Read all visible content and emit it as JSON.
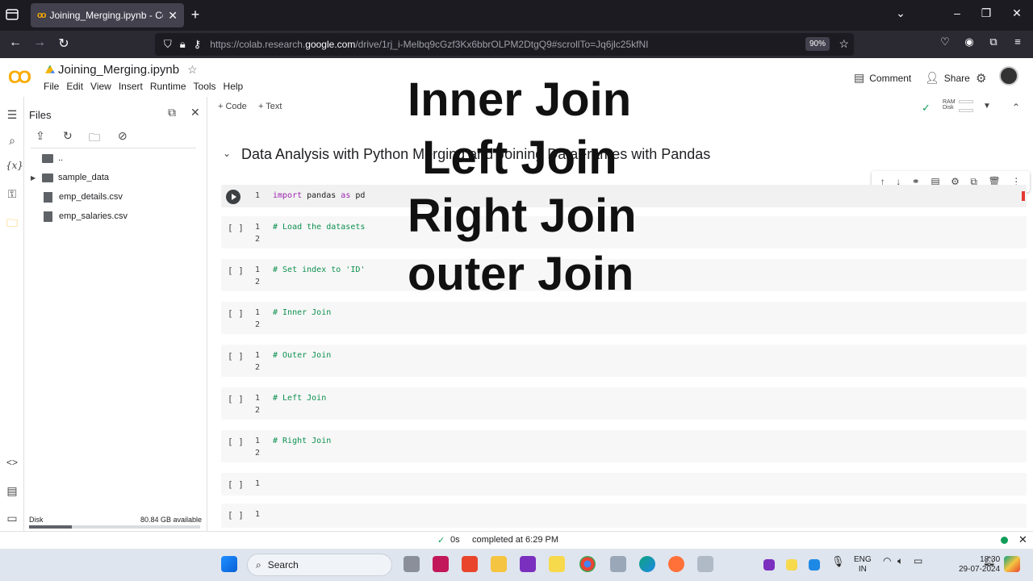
{
  "browser": {
    "tab_title": "Joining_Merging.ipynb - Colab",
    "url_prefix": "https://colab.research.",
    "url_domain": "google.com",
    "url_suffix": "/drive/1rj_i-Melbq9cGzf3Kx6bbrOLPM2DtgQ9#scrollTo=Jq6jlc25kfNI",
    "zoom": "90%"
  },
  "colab": {
    "logo": "CO",
    "title": "Joining_Merging.ipynb",
    "menu": [
      "File",
      "Edit",
      "View",
      "Insert",
      "Runtime",
      "Tools",
      "Help"
    ],
    "comment_label": "Comment",
    "share_label": "Share"
  },
  "files_panel": {
    "title": "Files",
    "items": [
      {
        "name": "..",
        "type": "parent"
      },
      {
        "name": "sample_data",
        "type": "folder"
      },
      {
        "name": "emp_details.csv",
        "type": "file"
      },
      {
        "name": "emp_salaries.csv",
        "type": "file"
      }
    ],
    "disk_label": "Disk",
    "disk_available": "80.84 GB available",
    "disk_used_fraction": 0.25
  },
  "toolbar": {
    "code_label": "+ Code",
    "text_label": "+ Text",
    "ram_label": "RAM",
    "disk_label": "Disk"
  },
  "section_heading": "Data Analysis with Python Merging and Joining DataFrames with Pandas",
  "cells": [
    {
      "bracket": "",
      "lines": [
        "1"
      ],
      "code_kw": "import",
      "code_rest": " pandas ",
      "code_kw2": "as",
      "code_rest2": " pd",
      "active": true
    },
    {
      "bracket": "[ ]",
      "lines": [
        "1",
        "2"
      ],
      "code": "# Load the datasets"
    },
    {
      "bracket": "[ ]",
      "lines": [
        "1",
        "2"
      ],
      "code": "# Set index to 'ID'"
    },
    {
      "bracket": "[ ]",
      "lines": [
        "1",
        "2"
      ],
      "code": "# Inner Join"
    },
    {
      "bracket": "[ ]",
      "lines": [
        "1",
        "2"
      ],
      "code": "# Outer Join"
    },
    {
      "bracket": "[ ]",
      "lines": [
        "1",
        "2"
      ],
      "code": "# Left Join"
    },
    {
      "bracket": "[ ]",
      "lines": [
        "1",
        "2"
      ],
      "code": "# Right Join"
    },
    {
      "bracket": "[ ]",
      "lines": [
        "1"
      ],
      "code": ""
    },
    {
      "bracket": "[ ]",
      "lines": [
        "1"
      ],
      "code": ""
    }
  ],
  "overlay": [
    "Inner Join",
    "Left Join",
    "Right Join",
    "outer Join"
  ],
  "status": {
    "time": "0s",
    "message": "completed at 6:29 PM"
  },
  "taskbar": {
    "search_label": "Search",
    "lang_top": "ENG",
    "lang_bottom": "IN",
    "time": "18:30",
    "date": "29-07-2024"
  },
  "colors": {
    "accent": "#f9ab00",
    "comment_green": "#0d904f",
    "keyword_purple": "#9c27b0"
  }
}
